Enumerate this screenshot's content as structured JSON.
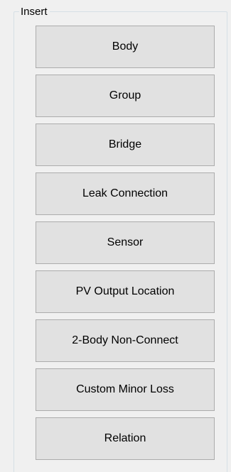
{
  "insert_panel": {
    "title": "Insert",
    "buttons": [
      {
        "id": "body",
        "label": "Body"
      },
      {
        "id": "group",
        "label": "Group"
      },
      {
        "id": "bridge",
        "label": "Bridge"
      },
      {
        "id": "leak-connection",
        "label": "Leak Connection"
      },
      {
        "id": "sensor",
        "label": "Sensor"
      },
      {
        "id": "pv-output-location",
        "label": "PV Output Location"
      },
      {
        "id": "2-body-non-connect",
        "label": "2-Body Non-Connect"
      },
      {
        "id": "custom-minor-loss",
        "label": "Custom Minor Loss"
      },
      {
        "id": "relation",
        "label": "Relation"
      }
    ]
  },
  "colors": {
    "window_background": "#f0f0f0",
    "button_face": "#e1e1e1",
    "button_border": "#acacac",
    "groupbox_border": "#d5dfe5",
    "text": "#000000"
  }
}
